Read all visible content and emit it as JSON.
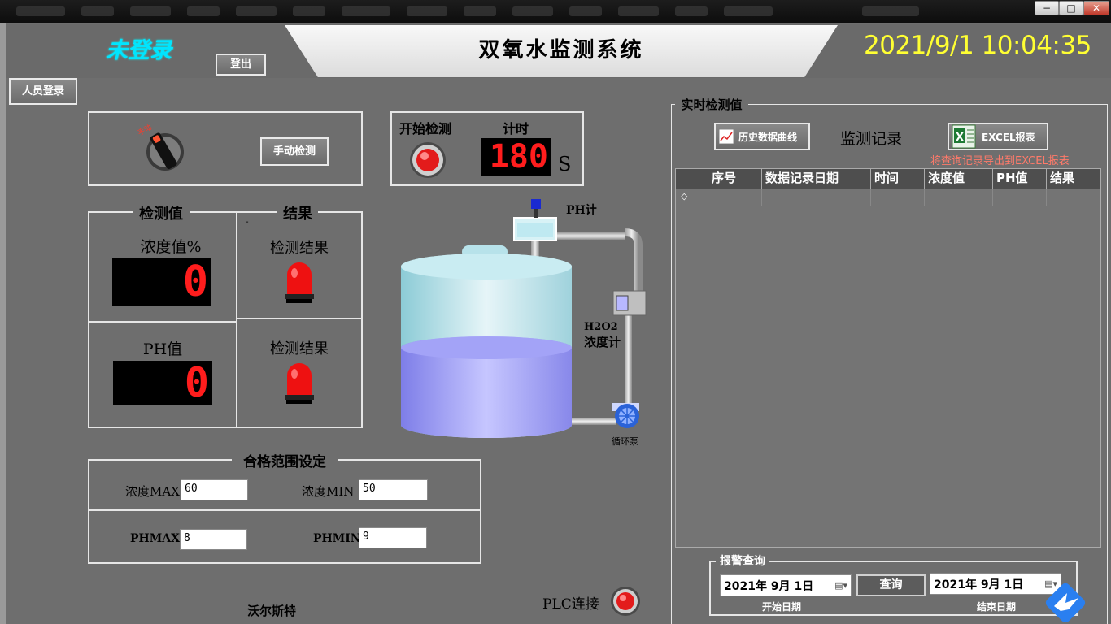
{
  "window": {
    "minimize_label": "−",
    "maximize_label": "□",
    "close_label": "✕"
  },
  "header": {
    "login_status": "未登录",
    "logout_label": "登出",
    "title": "双氧水监测系统",
    "datetime": "2021/9/1 10:04:35"
  },
  "person_login_label": "人员登录",
  "manual": {
    "knob_label": "手动",
    "button_label": "手动检测"
  },
  "detect": {
    "start_label": "开始检测",
    "timer_label": "计时",
    "timer_value": "180",
    "timer_unit": "S"
  },
  "measure": {
    "title": "检测值",
    "concentration_label": "浓度值%",
    "concentration_value": "0",
    "ph_label": "PH值",
    "ph_value": "0"
  },
  "result": {
    "title": "结果",
    "dash": "-",
    "result1_label": "检测结果",
    "result2_label": "检测结果"
  },
  "process": {
    "ph_meter_label": "PH计",
    "h2o2_meter_label_1": "H2O2",
    "h2o2_meter_label_2": "浓度计",
    "pump_label": "循环泵",
    "liquid_level": 0.42
  },
  "range": {
    "title": "合格范围设定",
    "conc_max_label": "浓度MAX",
    "conc_max_value": "60",
    "conc_min_label": "浓度MIN",
    "conc_min_value": "50",
    "ph_max_label": "PHMAX",
    "ph_max_value": "8",
    "ph_min_label": "PHMIN",
    "ph_min_value": "9"
  },
  "footer": {
    "company": "沃尔斯特",
    "plc_label": "PLC连接"
  },
  "realtime": {
    "group_title": "实时检测值",
    "history_button": "历史数据曲线",
    "records_title": "监测记录",
    "excel_button": "EXCEL报表",
    "excel_hint": "将查询记录导出到EXCEL报表",
    "columns": [
      "序号",
      "数据记录日期",
      "时间",
      "浓度值",
      "PH值",
      "结果"
    ],
    "row_marker": "◇"
  },
  "alarm": {
    "group_title": "报警查询",
    "start_date": "2021年 9月 1日",
    "start_caption": "开始日期",
    "query_button": "查询",
    "end_date": "2021年 9月 1日",
    "end_caption": "结束日期"
  },
  "colors": {
    "background": "#6e6e6e",
    "datetime": "#ffff33",
    "login_status": "#00e5ff",
    "segment_red": "#ff1d1d",
    "hint_red": "#ff7a6a",
    "lamp_red": "#ee1111"
  }
}
